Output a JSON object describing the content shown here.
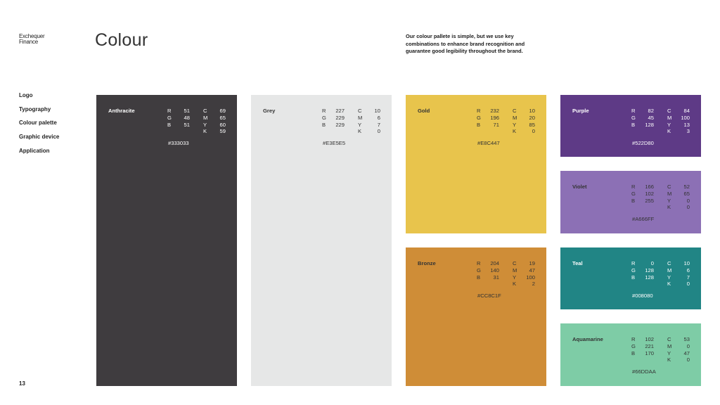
{
  "brand": {
    "line1": "Exchequer",
    "line2": "Finance"
  },
  "page_title": "Colour",
  "intro": "Our colour pallete is simple, but we use key combinations to enhance brand recognition and guarantee good legibility throughout the brand.",
  "nav": {
    "items": [
      {
        "label": "Logo"
      },
      {
        "label": "Typography"
      },
      {
        "label": "Colour palette"
      },
      {
        "label": "Graphic device"
      },
      {
        "label": "Application"
      }
    ]
  },
  "page_number": "13",
  "swatches": [
    {
      "name": "Anthracite",
      "color": "#333033",
      "text": "light",
      "rgb": [
        [
          "R",
          "51"
        ],
        [
          "G",
          "48"
        ],
        [
          "B",
          "51"
        ]
      ],
      "cmyk": [
        [
          "C",
          "69"
        ],
        [
          "M",
          "65"
        ],
        [
          "Y",
          "60"
        ],
        [
          "K",
          "59"
        ]
      ],
      "hex": "#333033"
    },
    {
      "name": "Grey",
      "color": "#E3E5E5",
      "text": "dark",
      "rgb": [
        [
          "R",
          "227"
        ],
        [
          "G",
          "229"
        ],
        [
          "B",
          "229"
        ]
      ],
      "cmyk": [
        [
          "C",
          "10"
        ],
        [
          "M",
          "6"
        ],
        [
          "Y",
          "7"
        ],
        [
          "K",
          "0"
        ]
      ],
      "hex": "#E3E5E5"
    },
    {
      "name": "Gold",
      "color": "#E8C447",
      "text": "dark",
      "rgb": [
        [
          "R",
          "232"
        ],
        [
          "G",
          "196"
        ],
        [
          "B",
          "71"
        ]
      ],
      "cmyk": [
        [
          "C",
          "10"
        ],
        [
          "M",
          "20"
        ],
        [
          "Y",
          "85"
        ],
        [
          "K",
          "0"
        ]
      ],
      "hex": "#E8C447"
    },
    {
      "name": "Bronze",
      "color": "#CC8C1F",
      "text": "dark",
      "rgb": [
        [
          "R",
          "204"
        ],
        [
          "G",
          "140"
        ],
        [
          "B",
          "31"
        ]
      ],
      "cmyk": [
        [
          "C",
          "19"
        ],
        [
          "M",
          "47"
        ],
        [
          "Y",
          "100"
        ],
        [
          "K",
          "2"
        ]
      ],
      "hex": "#CC8C1F"
    },
    {
      "name": "Purple",
      "color": "#522D80",
      "text": "light",
      "rgb": [
        [
          "R",
          "82"
        ],
        [
          "G",
          "45"
        ],
        [
          "B",
          "128"
        ]
      ],
      "cmyk": [
        [
          "C",
          "84"
        ],
        [
          "M",
          "100"
        ],
        [
          "Y",
          "13"
        ],
        [
          "K",
          "3"
        ]
      ],
      "hex": "#522D80"
    },
    {
      "name": "Violet",
      "color": "#A666FF",
      "text": "dark",
      "rgb": [
        [
          "R",
          "166"
        ],
        [
          "G",
          "102"
        ],
        [
          "B",
          "255"
        ]
      ],
      "cmyk": [
        [
          "C",
          "52"
        ],
        [
          "M",
          "65"
        ],
        [
          "Y",
          "0"
        ],
        [
          "K",
          "0"
        ]
      ],
      "hex": "#A666FF"
    },
    {
      "name": "Teal",
      "color": "#008080",
      "text": "light",
      "rgb": [
        [
          "R",
          "0"
        ],
        [
          "G",
          "128"
        ],
        [
          "B",
          "128"
        ]
      ],
      "cmyk": [
        [
          "C",
          "10"
        ],
        [
          "M",
          "6"
        ],
        [
          "Y",
          "7"
        ],
        [
          "K",
          "0"
        ]
      ],
      "hex": "#008080"
    },
    {
      "name": "Aquamarine",
      "color": "#66DDAA",
      "text": "dark",
      "rgb": [
        [
          "R",
          "102"
        ],
        [
          "G",
          "221"
        ],
        [
          "B",
          "170"
        ]
      ],
      "cmyk": [
        [
          "C",
          "53"
        ],
        [
          "M",
          "0"
        ],
        [
          "Y",
          "47"
        ],
        [
          "K",
          "0"
        ]
      ],
      "hex": "#66DDAA"
    }
  ]
}
